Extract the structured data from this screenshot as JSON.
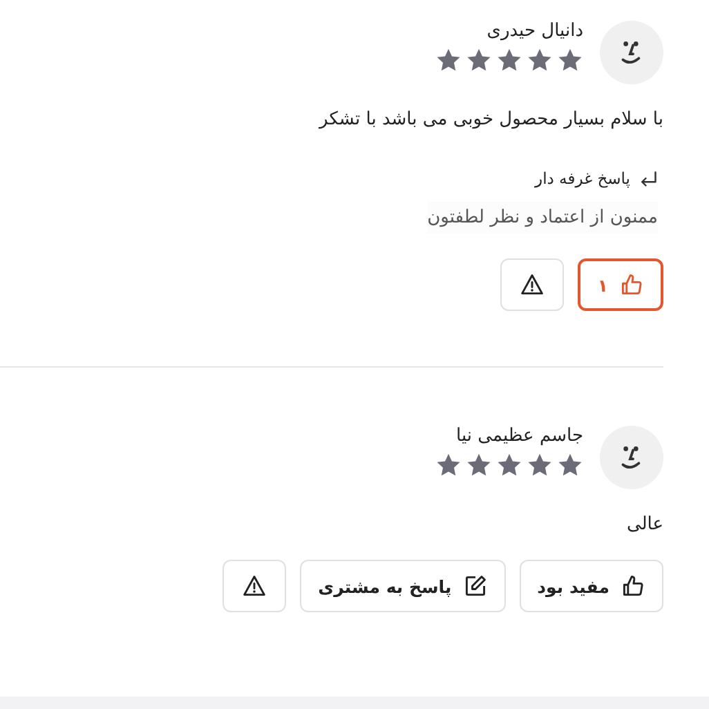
{
  "reviews": [
    {
      "name": "دانیال حیدری",
      "stars": 5,
      "comment": "با سلام بسیار محصول خوبی می باشد با تشکر",
      "seller_reply": {
        "title": "پاسخ غرفه دار",
        "text": "ممنون از اعتماد و نظر لطفتون"
      },
      "helpful": {
        "count": "۱",
        "selected": true
      }
    },
    {
      "name": "جاسم عظیمی نیا",
      "stars": 5,
      "comment": "عالی",
      "helpful": {
        "label": "مفید بود",
        "selected": false
      },
      "reply_button": "پاسخ به مشتری"
    }
  ]
}
